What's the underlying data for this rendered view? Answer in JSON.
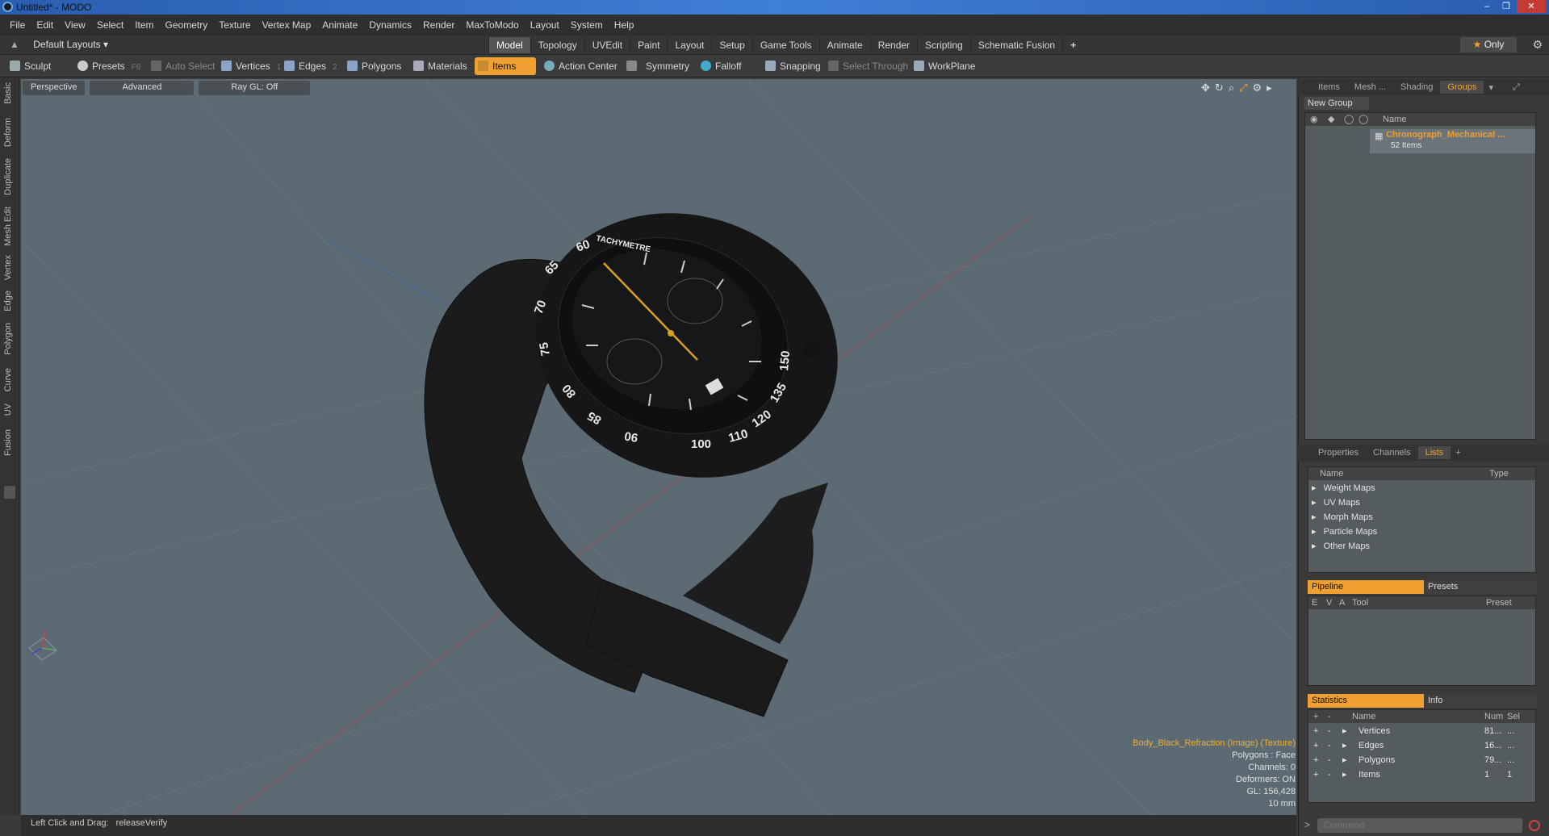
{
  "window": {
    "title": "Untitled* - MODO"
  },
  "menu": [
    "File",
    "Edit",
    "View",
    "Select",
    "Item",
    "Geometry",
    "Texture",
    "Vertex Map",
    "Animate",
    "Dynamics",
    "Render",
    "MaxToModo",
    "Layout",
    "System",
    "Help"
  ],
  "layout": {
    "dropdown": "Default Layouts",
    "tabs": [
      "Model",
      "Topology",
      "UVEdit",
      "Paint",
      "Layout",
      "Setup",
      "Game Tools",
      "Animate",
      "Render",
      "Scripting",
      "Schematic Fusion"
    ],
    "active_tab": "Model",
    "only_label": "Only"
  },
  "toolbar": {
    "sculpt": "Sculpt",
    "presets": "Presets",
    "presets_key": "F6",
    "auto_select": "Auto Select",
    "vertices": "Vertices",
    "vertices_key": "1",
    "edges": "Edges",
    "edges_key": "2",
    "polygons": "Polygons",
    "materials": "Materials",
    "items": "Items",
    "action_center": "Action Center",
    "symmetry": "Symmetry",
    "falloff": "Falloff",
    "snapping": "Snapping",
    "select_through": "Select Through",
    "workplane": "WorkPlane"
  },
  "left_tabs": [
    "Basic",
    "Deform",
    "Duplicate",
    "Mesh Edit",
    "Vertex",
    "Edge",
    "Polygon",
    "Curve",
    "UV",
    "Fusion"
  ],
  "viewport": {
    "view": "Perspective",
    "shading": "Advanced",
    "raygl": "Ray GL: Off",
    "stats": {
      "texture": "Body_Black_Refraction (Image) (Texture)",
      "polygons": "Polygons : Face",
      "channels": "Channels: 0",
      "deformers": "Deformers: ON",
      "gl": "GL: 156,428",
      "scale": "10 mm"
    },
    "dial_numbers": [
      "60",
      "65",
      "70",
      "75",
      "80",
      "85",
      "90",
      "100",
      "110",
      "120",
      "135",
      "150"
    ],
    "bezel_text": "TACHYMETRE"
  },
  "status": {
    "hint": "Left Click and Drag:",
    "action": "releaseVerify"
  },
  "groups_panel": {
    "tabs": [
      "Items",
      "Mesh ...",
      "Shading",
      "Groups"
    ],
    "active": "Groups",
    "new_group": "New Group",
    "col_name": "Name",
    "group_name": "Chronograph_Mechanical ...",
    "group_count": "52 Items"
  },
  "lists_panel": {
    "tabs": [
      "Properties",
      "Channels",
      "Lists"
    ],
    "active": "Lists",
    "col_name": "Name",
    "col_type": "Type",
    "items": [
      "Weight Maps",
      "UV Maps",
      "Morph Maps",
      "Particle Maps",
      "Other Maps"
    ]
  },
  "pipeline_panel": {
    "tab_active": "Pipeline",
    "tab_other": "Presets",
    "cols": [
      "E",
      "V",
      "A",
      "Tool",
      "Preset"
    ]
  },
  "stats_panel": {
    "tab_active": "Statistics",
    "tab_other": "Info",
    "cols": [
      "Name",
      "Num",
      "Sel"
    ],
    "rows": [
      {
        "name": "Vertices",
        "num": "81...",
        "sel": "..."
      },
      {
        "name": "Edges",
        "num": "16...",
        "sel": "..."
      },
      {
        "name": "Polygons",
        "num": "79...",
        "sel": "..."
      },
      {
        "name": "Items",
        "num": "1",
        "sel": "1"
      }
    ]
  },
  "command": {
    "placeholder": "Command"
  },
  "colors": {
    "accent": "#f0a030",
    "viewport_bg": "#5b6a73",
    "title_bar": "#3f7fd6"
  }
}
